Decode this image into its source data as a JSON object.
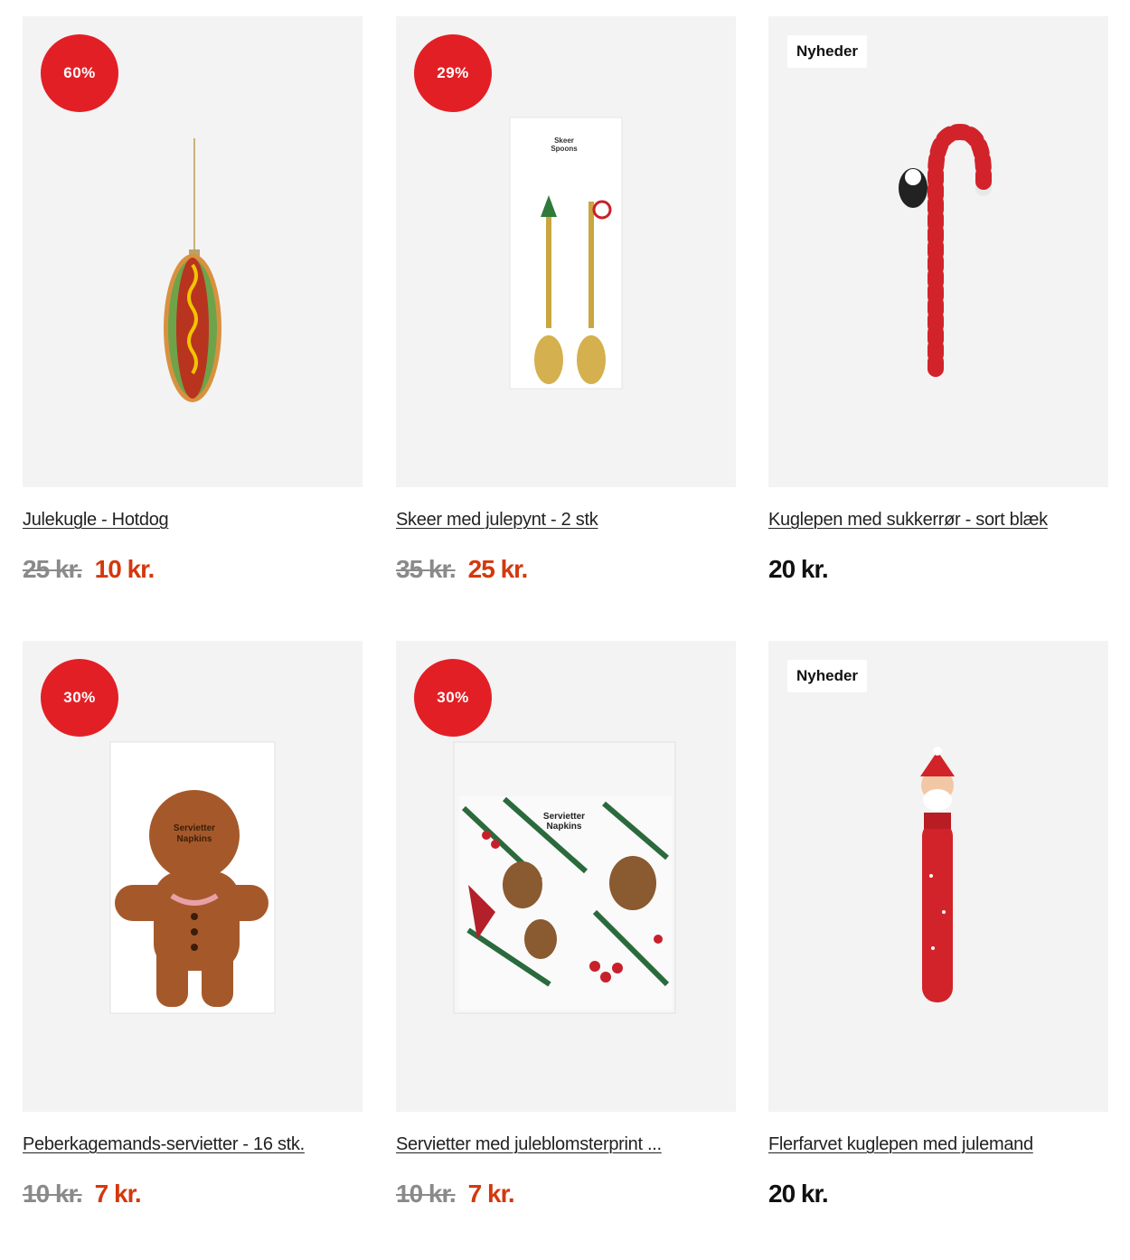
{
  "products": [
    {
      "title": "Julekugle - Hotdog",
      "badge": "60%",
      "badge_type": "discount",
      "old_price": "25 kr.",
      "price": "10 kr.",
      "image": "hotdog-ornament"
    },
    {
      "title": "Skeer med julepynt - 2 stk",
      "badge": "29%",
      "badge_type": "discount",
      "old_price": "35 kr.",
      "price": "25 kr.",
      "image": "gold-spoons",
      "package_text": [
        "Skeer",
        "Spoons"
      ]
    },
    {
      "title": "Kuglepen med sukkerrør - sort blæk",
      "badge": "Nyheder",
      "badge_type": "new",
      "old_price": "",
      "price": "20 kr.",
      "image": "candy-cane-pen"
    },
    {
      "title": "Peberkagemands-servietter - 16 stk.",
      "badge": "30%",
      "badge_type": "discount",
      "old_price": "10 kr.",
      "price": "7 kr.",
      "image": "gingerbread-napkins",
      "package_text": [
        "Servietter",
        "Napkins"
      ]
    },
    {
      "title": "Servietter med juleblomsterprint ...",
      "badge": "30%",
      "badge_type": "discount",
      "old_price": "10 kr.",
      "price": "7 kr.",
      "image": "holly-napkins",
      "package_text": [
        "Servietter",
        "Napkins"
      ]
    },
    {
      "title": "Flerfarvet kuglepen med julemand",
      "badge": "Nyheder",
      "badge_type": "new",
      "old_price": "",
      "price": "20 kr.",
      "image": "santa-pen"
    }
  ],
  "colors": {
    "discount_badge": "#e31f26",
    "sale_price": "#d4380d",
    "card_background": "#f3f3f3"
  }
}
